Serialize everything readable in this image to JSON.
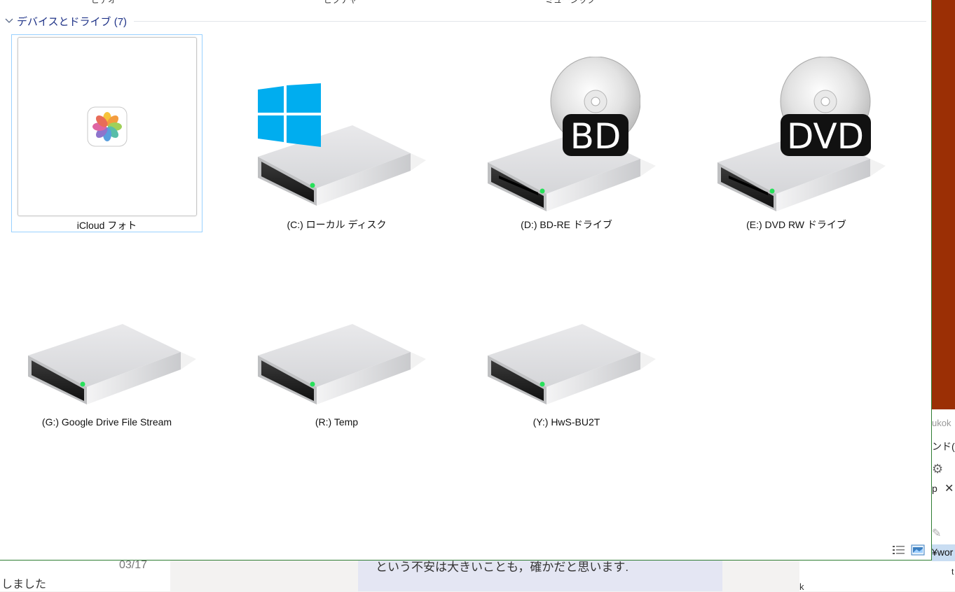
{
  "top_cut_labels": [
    "ビデオ",
    "ピクチャ",
    "ミュージック"
  ],
  "group": {
    "title": "デバイスとドライブ (7)"
  },
  "drives": [
    {
      "label": "iCloud フォト",
      "icon": "icloud-photos-icon",
      "selected": true
    },
    {
      "label": "(C:) ローカル ディスク",
      "icon": "windows-drive-icon"
    },
    {
      "label": "(D:) BD-RE ドライブ",
      "icon": "bd-drive-icon",
      "badge": "BD"
    },
    {
      "label": "(E:) DVD RW ドライブ",
      "icon": "dvd-drive-icon",
      "badge": "DVD"
    },
    {
      "label": "(G:) Google Drive File Stream",
      "icon": "hard-drive-icon"
    },
    {
      "label": "(R:) Temp",
      "icon": "hard-drive-icon"
    },
    {
      "label": "(Y:) HwS-BU2T",
      "icon": "hard-drive-icon"
    }
  ],
  "view_buttons": [
    "details-view-icon",
    "large-icons-view-icon"
  ],
  "background": {
    "date": "03/17",
    "status_text": "しました",
    "message_text": "という不安は大きいことも，確かだと思います.",
    "right_app": {
      "text1": "ukok",
      "text2": "ンド(C",
      "tab_text": "p",
      "path_text": "¥wor"
    },
    "bottom_right_char": "k",
    "far_right_char": "t"
  },
  "colors": {
    "group_title": "#1e3287",
    "selection_border": "#99d1ff",
    "window_border": "#2e7d32",
    "taskbar_accent": "#9b2f05"
  }
}
